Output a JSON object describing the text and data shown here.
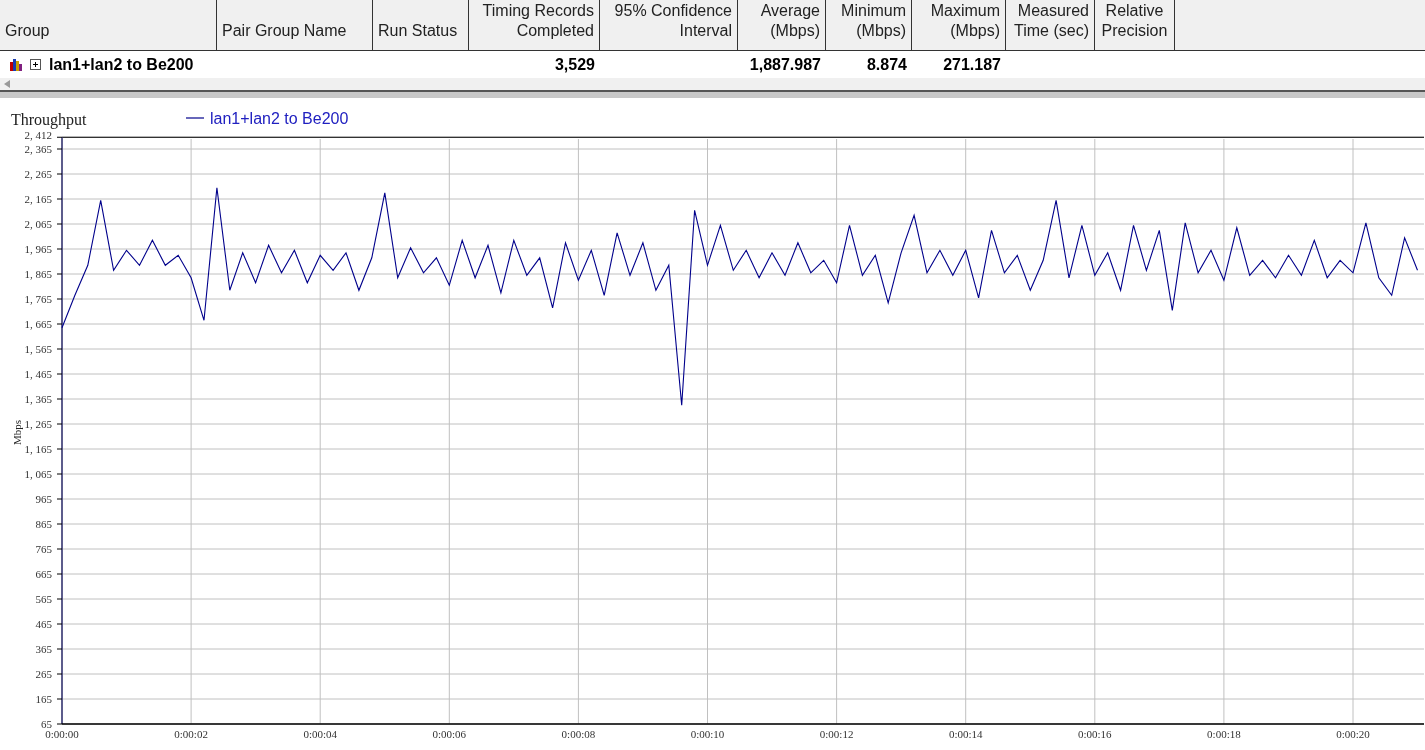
{
  "table": {
    "columns": [
      {
        "label": "Group"
      },
      {
        "label": "Pair Group Name"
      },
      {
        "label": "Run Status"
      },
      {
        "label": "Timing Records Completed"
      },
      {
        "label": "95% Confidence Interval"
      },
      {
        "label": "Average (Mbps)"
      },
      {
        "label": "Minimum (Mbps)"
      },
      {
        "label": "Maximum (Mbps)"
      },
      {
        "label": "Measured Time (sec)"
      },
      {
        "label": "Relative Precision"
      }
    ],
    "rows": [
      {
        "group": "lan1+lan2 to Be200",
        "expanded": false,
        "timing_records_completed": "3,529",
        "average": "1,887.987",
        "minimum": "8.874",
        "maximum": "271.187"
      }
    ]
  },
  "chart": {
    "chart_data": {
      "type": "line",
      "grid": true,
      "title": "Throughput",
      "ylabel": "Mbps",
      "xlim": [
        0,
        21.1
      ],
      "ylim": [
        65,
        2412
      ],
      "x": [
        0,
        0.2,
        0.4,
        0.6,
        0.8,
        1,
        1.2,
        1.4,
        1.6,
        1.8,
        2,
        2.2,
        2.4,
        2.6,
        2.8,
        3,
        3.2,
        3.4,
        3.6,
        3.8,
        4,
        4.2,
        4.4,
        4.6,
        4.8,
        5,
        5.2,
        5.4,
        5.6,
        5.8,
        6,
        6.2,
        6.4,
        6.6,
        6.8,
        7,
        7.2,
        7.4,
        7.6,
        7.8,
        8,
        8.2,
        8.4,
        8.6,
        8.8,
        9,
        9.2,
        9.4,
        9.6,
        9.8,
        10,
        10.2,
        10.4,
        10.6,
        10.8,
        11,
        11.2,
        11.4,
        11.6,
        11.8,
        12,
        12.2,
        12.4,
        12.6,
        12.8,
        13,
        13.2,
        13.4,
        13.6,
        13.8,
        14,
        14.2,
        14.4,
        14.6,
        14.8,
        15,
        15.2,
        15.4,
        15.6,
        15.8,
        16,
        16.2,
        16.4,
        16.6,
        16.8,
        17,
        17.2,
        17.4,
        17.6,
        17.8,
        18,
        18.2,
        18.4,
        18.6,
        18.8,
        19,
        19.2,
        19.4,
        19.6,
        19.8,
        20,
        20.2,
        20.4,
        20.6,
        20.8,
        21
      ],
      "series": [
        {
          "name": "lan1+lan2 to Be200",
          "color": "#00008b",
          "values": [
            1650,
            1780,
            1900,
            2160,
            1880,
            1960,
            1900,
            2000,
            1900,
            1940,
            1850,
            1680,
            2210,
            1800,
            1950,
            1830,
            1980,
            1870,
            1960,
            1830,
            1940,
            1880,
            1950,
            1800,
            1930,
            2190,
            1850,
            1970,
            1870,
            1930,
            1820,
            2000,
            1850,
            1980,
            1790,
            2000,
            1860,
            1930,
            1730,
            1990,
            1840,
            1960,
            1780,
            2030,
            1860,
            1990,
            1800,
            1900,
            1340,
            2120,
            1900,
            2060,
            1880,
            1960,
            1850,
            1950,
            1860,
            1990,
            1870,
            1920,
            1830,
            2060,
            1860,
            1940,
            1750,
            1950,
            2100,
            1870,
            1960,
            1860,
            1960,
            1770,
            2040,
            1870,
            1940,
            1800,
            1920,
            2160,
            1850,
            2060,
            1860,
            1950,
            1800,
            2060,
            1880,
            2040,
            1720,
            2070,
            1870,
            1960,
            1840,
            2050,
            1860,
            1920,
            1850,
            1940,
            1860,
            2000,
            1850,
            1920,
            1870,
            2070,
            1850,
            1780,
            2010,
            1880
          ]
        }
      ],
      "xticks": [
        {
          "value": 0,
          "label": "0:00:00"
        },
        {
          "value": 2,
          "label": "0:00:02"
        },
        {
          "value": 4,
          "label": "0:00:04"
        },
        {
          "value": 6,
          "label": "0:00:06"
        },
        {
          "value": 8,
          "label": "0:00:08"
        },
        {
          "value": 10,
          "label": "0:00:10"
        },
        {
          "value": 12,
          "label": "0:00:12"
        },
        {
          "value": 14,
          "label": "0:00:14"
        },
        {
          "value": 16,
          "label": "0:00:16"
        },
        {
          "value": 18,
          "label": "0:00:18"
        },
        {
          "value": 20,
          "label": "0:00:20"
        }
      ],
      "yticks": [
        {
          "value": 2412,
          "label": "2, 412"
        },
        {
          "value": 2365,
          "label": "2, 365"
        },
        {
          "value": 2265,
          "label": "2, 265"
        },
        {
          "value": 2165,
          "label": "2, 165"
        },
        {
          "value": 2065,
          "label": "2, 065"
        },
        {
          "value": 1965,
          "label": "1, 965"
        },
        {
          "value": 1865,
          "label": "1, 865"
        },
        {
          "value": 1765,
          "label": "1, 765"
        },
        {
          "value": 1665,
          "label": "1, 665"
        },
        {
          "value": 1565,
          "label": "1, 565"
        },
        {
          "value": 1465,
          "label": "1, 465"
        },
        {
          "value": 1365,
          "label": "1, 365"
        },
        {
          "value": 1265,
          "label": "1, 265"
        },
        {
          "value": 1165,
          "label": "1, 165"
        },
        {
          "value": 1065,
          "label": "1, 065"
        },
        {
          "value": 965,
          "label": "965"
        },
        {
          "value": 865,
          "label": "865"
        },
        {
          "value": 765,
          "label": "765"
        },
        {
          "value": 665,
          "label": "665"
        },
        {
          "value": 565,
          "label": "565"
        },
        {
          "value": 465,
          "label": "465"
        },
        {
          "value": 365,
          "label": "365"
        },
        {
          "value": 265,
          "label": "265"
        },
        {
          "value": 165,
          "label": "165"
        },
        {
          "value": 65,
          "label": "65"
        }
      ]
    }
  }
}
